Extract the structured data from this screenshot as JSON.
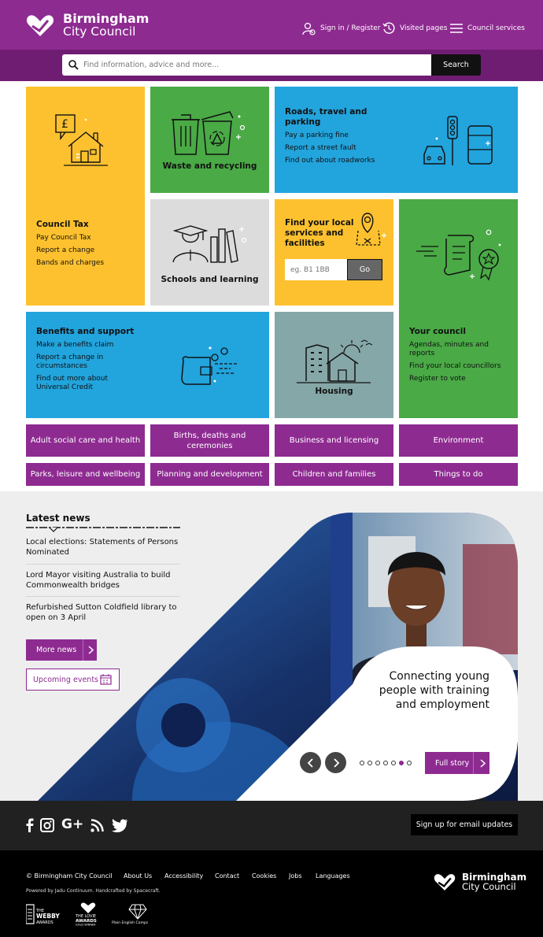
{
  "header": {
    "logo_line1": "Birmingham",
    "logo_line2": "City Council",
    "sign_in": "Sign in / Register",
    "visited": "Visited pages",
    "services": "Council services"
  },
  "search": {
    "placeholder": "Find information, advice and more...",
    "button": "Search"
  },
  "tiles": {
    "council_tax": {
      "title": "Council Tax",
      "links": [
        "Pay Council Tax",
        "Report a change",
        "Bands and charges"
      ]
    },
    "waste": {
      "title": "Waste and recycling"
    },
    "roads": {
      "title": "Roads, travel and parking",
      "links": [
        "Pay a parking fine",
        "Report a street fault",
        "Find out about roadworks"
      ]
    },
    "schools": {
      "title": "Schools and learning"
    },
    "local": {
      "title": "Find your local services and facilities",
      "placeholder": "eg. B1 1BB",
      "button": "Go"
    },
    "benefits": {
      "title": "Benefits and support",
      "links": [
        "Make a benefits claim",
        "Report a change in circumstances",
        "Find out more about Universal Credit"
      ]
    },
    "housing": {
      "title": "Housing"
    },
    "your_council": {
      "title": "Your council",
      "links": [
        "Agendas, minutes and reports",
        "Find your local councillors",
        "Register to vote"
      ]
    }
  },
  "categories": [
    "Adult social care and health",
    "Births, deaths and ceremonies",
    "Business and licensing",
    "Environment",
    "Parks, leisure and wellbeing",
    "Planning and development",
    "Children and families",
    "Things to do"
  ],
  "news": {
    "title": "Latest news",
    "items": [
      "Local elections: Statements of Persons Nominated",
      "Lord Mayor visiting Australia to build Commonwealth bridges",
      "Refurbished Sutton Coldfield library to open on 3 April"
    ],
    "more_news": "More news",
    "upcoming_events": "Upcoming events"
  },
  "hero": {
    "text": "Connecting young people with training and employment",
    "full_story": "Full story",
    "slide_count": 7,
    "active_slide": 5
  },
  "footer": {
    "email_signup": "Sign up for email updates",
    "copyright": "© Birmingham City Council",
    "links": [
      "About Us",
      "Accessibility",
      "Contact",
      "Cookies",
      "Jobs",
      "Languages"
    ],
    "powered": "Powered by Jadu Continuum. Handcrafted by Spacecraft.",
    "awards": [
      "THE WEBBY AWARDS",
      "THE LOVIE AWARDS GOLD WINNER",
      "Plain English Campaign"
    ]
  },
  "colors": {
    "purple": "#8e2b91",
    "yellow": "#fdc12f",
    "green": "#4aaa46",
    "blue": "#22a4dd",
    "grey": "#dcdcdc",
    "teal_grey": "#86a7a7"
  }
}
